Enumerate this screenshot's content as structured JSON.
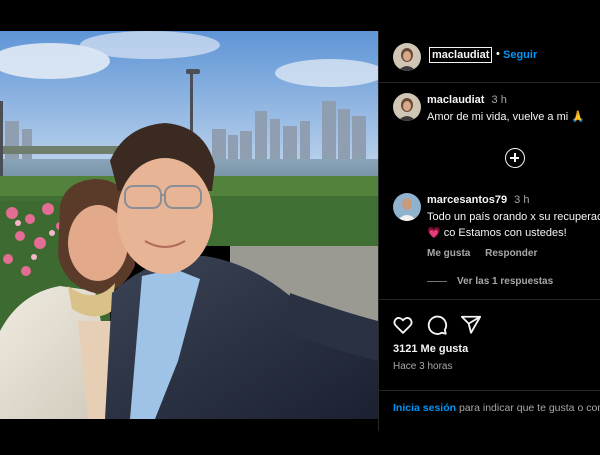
{
  "post": {
    "author": "maclaudiat",
    "separator": "•",
    "follow_label": "Seguir"
  },
  "caption": {
    "username": "maclaudiat",
    "time": "3 h",
    "text": "Amor de mi vida, vuelve a mi 🙏"
  },
  "comments": [
    {
      "username": "marcesantos79",
      "time": "3 h",
      "text_line1": "Todo un país orando x su recuperación",
      "text_line2": "💗 co Estamos con ustedes!",
      "like_label": "Me gusta",
      "reply_label": "Responder",
      "replies_label": "Ver las 1 respuestas"
    }
  ],
  "engagement": {
    "likes": "3121 Me gusta",
    "time_ago": "Hace 3 horas"
  },
  "login_prompt": {
    "link": "Inicia sesión",
    "text": " para indicar que te gusta o comentar."
  },
  "icons": {
    "like": "heart-icon",
    "comment": "comment-icon",
    "share": "share-icon",
    "more": "plus-circle-icon"
  },
  "colors": {
    "background": "#000000",
    "accent": "#0095f6",
    "text": "#f5f5f5",
    "muted": "#a8a8a8"
  }
}
